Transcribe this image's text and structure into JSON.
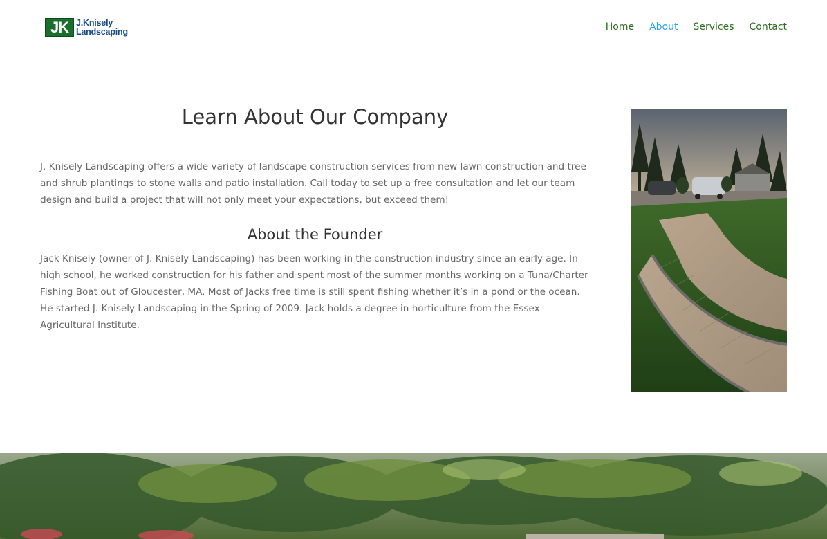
{
  "brand": {
    "logo_mark": "JK",
    "logo_line1": "J.Knisely",
    "logo_line2": "Landscaping"
  },
  "nav": {
    "items": [
      {
        "label": "Home"
      },
      {
        "label": "About"
      },
      {
        "label": "Services"
      },
      {
        "label": "Contact"
      }
    ],
    "active": "About"
  },
  "main": {
    "title": "Learn About Our Company",
    "intro": "J. Knisely Landscaping offers a wide variety of landscape construction services from new lawn construction and tree and shrub plantings to stone walls and patio installation. Call today to set up a free consultation and let our team design and build a project that will not only meet your expectations, but exceed them!",
    "founder_title": "About the Founder",
    "founder_text": "Jack Knisely (owner of J. Knisely Landscaping) has been working in the construction industry since an early age. In high school, he worked construction for his father and spent most of the summer months working on a Tuna/Charter Fishing Boat out of Gloucester, MA. Most of Jacks free time is still spent fishing whether it’s in a pond or the ocean. He started J. Knisely Landscaping in the Spring of 2009. Jack holds a degree in horticulture from the Essex Agricultural Institute."
  },
  "colors": {
    "nav_link": "#2e6d1e",
    "nav_active": "#2ea3f2",
    "heading": "#333333",
    "body_text": "#666666",
    "logo_green": "#1a6f2c",
    "logo_blue": "#174b8a"
  }
}
